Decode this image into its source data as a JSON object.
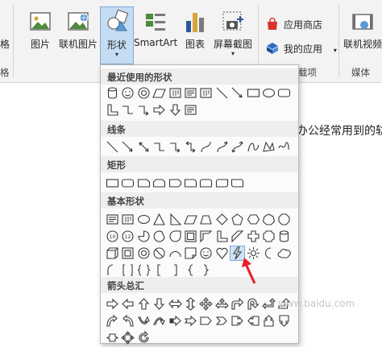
{
  "ribbon": {
    "left_cut_label": "格",
    "left_cut_group": "格",
    "buttons": {
      "picture": "图片",
      "online_picture": "联机图片",
      "shapes": "形状",
      "smartart": "SmartArt",
      "chart": "图表",
      "screenshot": "屏幕截图",
      "online_video": "联机视频"
    },
    "app_store": "应用商店",
    "my_apps": "我的应用",
    "groups": {
      "addins": "载项",
      "media": "媒体"
    }
  },
  "shapes_menu": {
    "sections": {
      "recent": "最近使用的形状",
      "lines": "线条",
      "rectangles": "矩形",
      "basic": "基本形状",
      "arrows": "箭头总汇"
    }
  },
  "document": {
    "text": "办公经常用到的轨"
  },
  "watermark": {
    "text": "www.baidu.com"
  },
  "colors": {
    "accent": "#2b579a",
    "store_red": "#d9332c",
    "my_apps_blue": "#2b6cc4",
    "highlight": "#c5dcf2",
    "pointer_red": "#e8202a"
  },
  "icons": [
    "picture-icon",
    "online-picture-icon",
    "shapes-icon",
    "smartart-icon",
    "chart-icon",
    "screenshot-icon",
    "store-icon",
    "my-apps-icon",
    "online-video-icon",
    "red-pointer-arrow"
  ]
}
